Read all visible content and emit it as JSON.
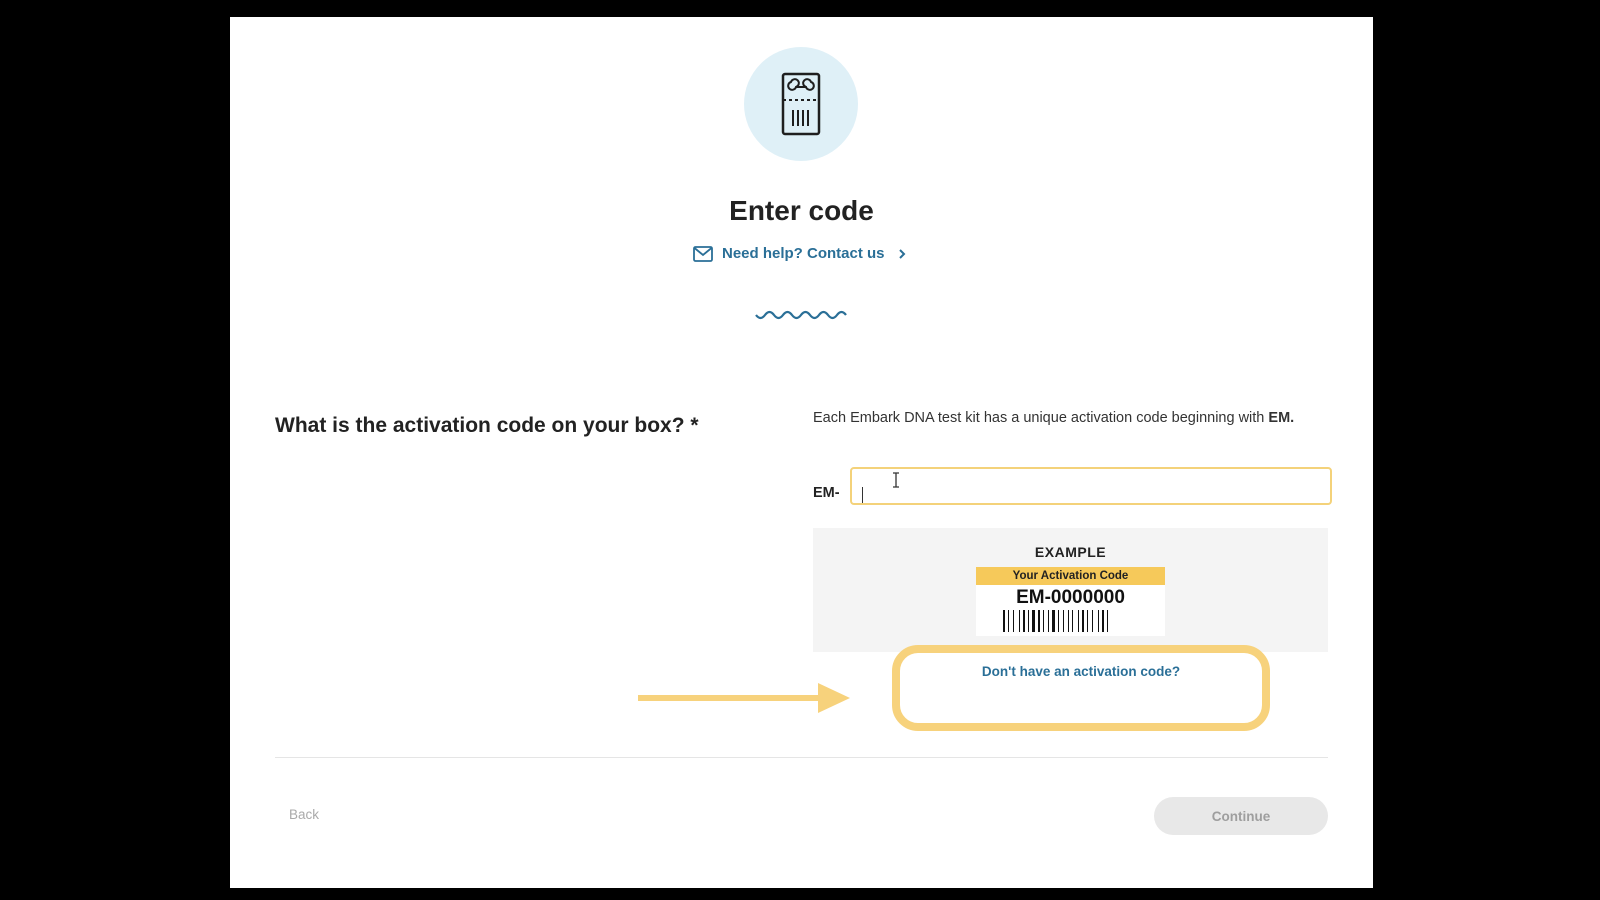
{
  "header": {
    "icon": "test-kit-icon",
    "title": "Enter code",
    "help_link": "Need help? Contact us",
    "help_icon": "mail-icon",
    "help_chevron": "chevron-right-icon"
  },
  "question": {
    "label": "What is the activation code on your box? *",
    "description_prefix": "Each Embark DNA test kit has a unique activation code beginning with ",
    "description_bold": "EM",
    "description_suffix": "."
  },
  "code_field": {
    "prefix": "EM-",
    "value": "",
    "placeholder": ""
  },
  "example": {
    "label": "EXAMPLE",
    "card_band": "Your Activation Code",
    "card_code": "EM-0000000"
  },
  "no_code_link": "Don't have an activation code?",
  "footer": {
    "back_label": "Back",
    "continue_label": "Continue"
  },
  "colors": {
    "accent": "#2a6f97",
    "highlight": "#f7d27c",
    "icon_bg": "#dff0f7",
    "card_band": "#f6c95a"
  }
}
